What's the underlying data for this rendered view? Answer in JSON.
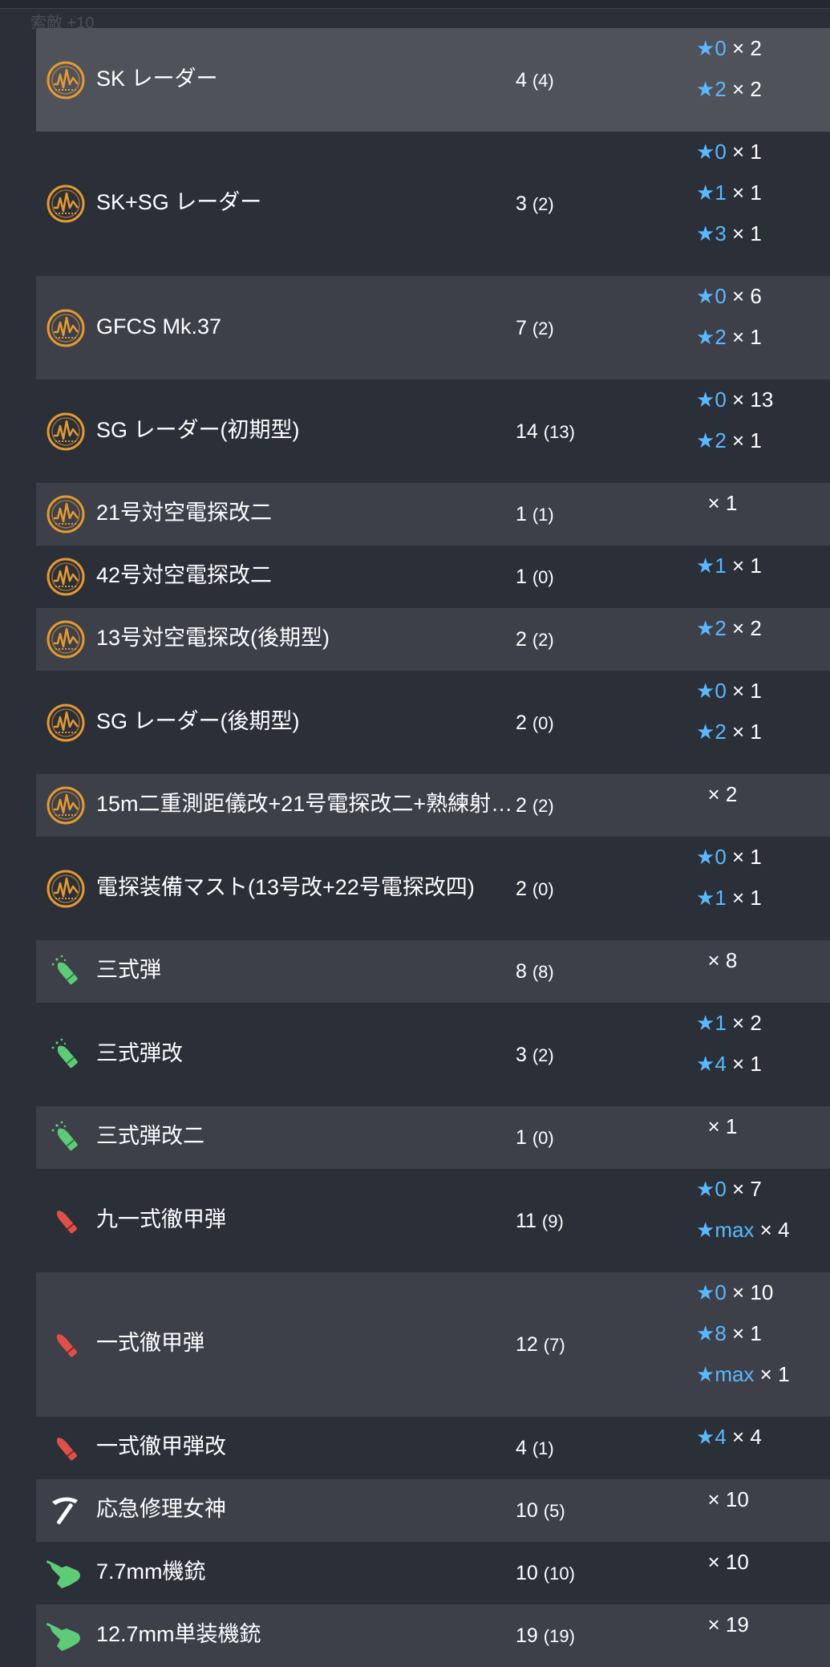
{
  "colors": {
    "accent_star": "#5ab8ff",
    "radar_icon": "#e49a34",
    "shell_green": "#5ecb78",
    "ap_red": "#e0504a",
    "row_alt": "#3d4048",
    "row_base": "#2b2f37"
  },
  "ghost_text": "索敵 +10",
  "rows": [
    {
      "name": "SK レーダー",
      "icon": "radar-icon",
      "total": "4",
      "avail": "(4)",
      "levels": [
        {
          "star": "★",
          "lvl": "0",
          "qty": "× 2"
        },
        {
          "star": "★",
          "lvl": "2",
          "qty": "× 2"
        }
      ]
    },
    {
      "name": "SK+SG レーダー",
      "icon": "radar-icon",
      "total": "3",
      "avail": "(2)",
      "levels": [
        {
          "star": "★",
          "lvl": "0",
          "qty": "× 1"
        },
        {
          "star": "★",
          "lvl": "1",
          "qty": "× 1"
        },
        {
          "star": "★",
          "lvl": "3",
          "qty": "× 1"
        }
      ]
    },
    {
      "name": "GFCS Mk.37",
      "icon": "radar-icon",
      "total": "7",
      "avail": "(2)",
      "levels": [
        {
          "star": "★",
          "lvl": "0",
          "qty": "× 6"
        },
        {
          "star": "★",
          "lvl": "2",
          "qty": "× 1"
        }
      ]
    },
    {
      "name": "SG レーダー(初期型)",
      "icon": "radar-icon",
      "total": "14",
      "avail": "(13)",
      "levels": [
        {
          "star": "★",
          "lvl": "0",
          "qty": "× 13"
        },
        {
          "star": "★",
          "lvl": "2",
          "qty": "× 1"
        }
      ]
    },
    {
      "name": "21号対空電探改二",
      "icon": "radar-icon",
      "total": "1",
      "avail": "(1)",
      "levels": [
        {
          "star": "",
          "lvl": "",
          "qty": "× 1"
        }
      ]
    },
    {
      "name": "42号対空電探改二",
      "icon": "radar-icon",
      "total": "1",
      "avail": "(0)",
      "levels": [
        {
          "star": "★",
          "lvl": "1",
          "qty": "× 1"
        }
      ]
    },
    {
      "name": "13号対空電探改(後期型)",
      "icon": "radar-icon",
      "total": "2",
      "avail": "(2)",
      "levels": [
        {
          "star": "★",
          "lvl": "2",
          "qty": "× 2"
        }
      ]
    },
    {
      "name": "SG レーダー(後期型)",
      "icon": "radar-icon",
      "total": "2",
      "avail": "(0)",
      "levels": [
        {
          "star": "★",
          "lvl": "0",
          "qty": "× 1"
        },
        {
          "star": "★",
          "lvl": "2",
          "qty": "× 1"
        }
      ]
    },
    {
      "name": "15m二重測距儀改+21号電探改二+熟練射…",
      "icon": "radar-icon",
      "total": "2",
      "avail": "(2)",
      "levels": [
        {
          "star": "",
          "lvl": "",
          "qty": "× 2"
        }
      ]
    },
    {
      "name": "電探装備マスト(13号改+22号電探改四)",
      "icon": "radar-icon",
      "total": "2",
      "avail": "(0)",
      "levels": [
        {
          "star": "★",
          "lvl": "0",
          "qty": "× 1"
        },
        {
          "star": "★",
          "lvl": "1",
          "qty": "× 1"
        }
      ]
    },
    {
      "name": "三式弾",
      "icon": "aa-shell-icon",
      "total": "8",
      "avail": "(8)",
      "levels": [
        {
          "star": "",
          "lvl": "",
          "qty": "× 8"
        }
      ]
    },
    {
      "name": "三式弾改",
      "icon": "aa-shell-icon",
      "total": "3",
      "avail": "(2)",
      "levels": [
        {
          "star": "★",
          "lvl": "1",
          "qty": "× 2"
        },
        {
          "star": "★",
          "lvl": "4",
          "qty": "× 1"
        }
      ]
    },
    {
      "name": "三式弾改二",
      "icon": "aa-shell-icon",
      "total": "1",
      "avail": "(0)",
      "levels": [
        {
          "star": "",
          "lvl": "",
          "qty": "× 1"
        }
      ]
    },
    {
      "name": "九一式徹甲弾",
      "icon": "ap-shell-icon",
      "total": "11",
      "avail": "(9)",
      "levels": [
        {
          "star": "★",
          "lvl": "0",
          "qty": "× 7"
        },
        {
          "star": "★",
          "lvl": "max",
          "qty": "× 4"
        }
      ]
    },
    {
      "name": "一式徹甲弾",
      "icon": "ap-shell-icon",
      "total": "12",
      "avail": "(7)",
      "levels": [
        {
          "star": "★",
          "lvl": "0",
          "qty": "× 10"
        },
        {
          "star": "★",
          "lvl": "8",
          "qty": "× 1"
        },
        {
          "star": "★",
          "lvl": "max",
          "qty": "× 1"
        }
      ]
    },
    {
      "name": "一式徹甲弾改",
      "icon": "ap-shell-icon",
      "total": "4",
      "avail": "(1)",
      "levels": [
        {
          "star": "★",
          "lvl": "4",
          "qty": "× 4"
        }
      ]
    },
    {
      "name": "応急修理女神",
      "icon": "repair-icon",
      "total": "10",
      "avail": "(5)",
      "levels": [
        {
          "star": "",
          "lvl": "",
          "qty": "× 10"
        }
      ]
    },
    {
      "name": "7.7mm機銃",
      "icon": "machine-gun-icon",
      "total": "10",
      "avail": "(10)",
      "levels": [
        {
          "star": "",
          "lvl": "",
          "qty": "× 10"
        }
      ]
    },
    {
      "name": "12.7mm単装機銃",
      "icon": "machine-gun-icon",
      "total": "19",
      "avail": "(19)",
      "levels": [
        {
          "star": "",
          "lvl": "",
          "qty": "× 19"
        }
      ]
    }
  ]
}
